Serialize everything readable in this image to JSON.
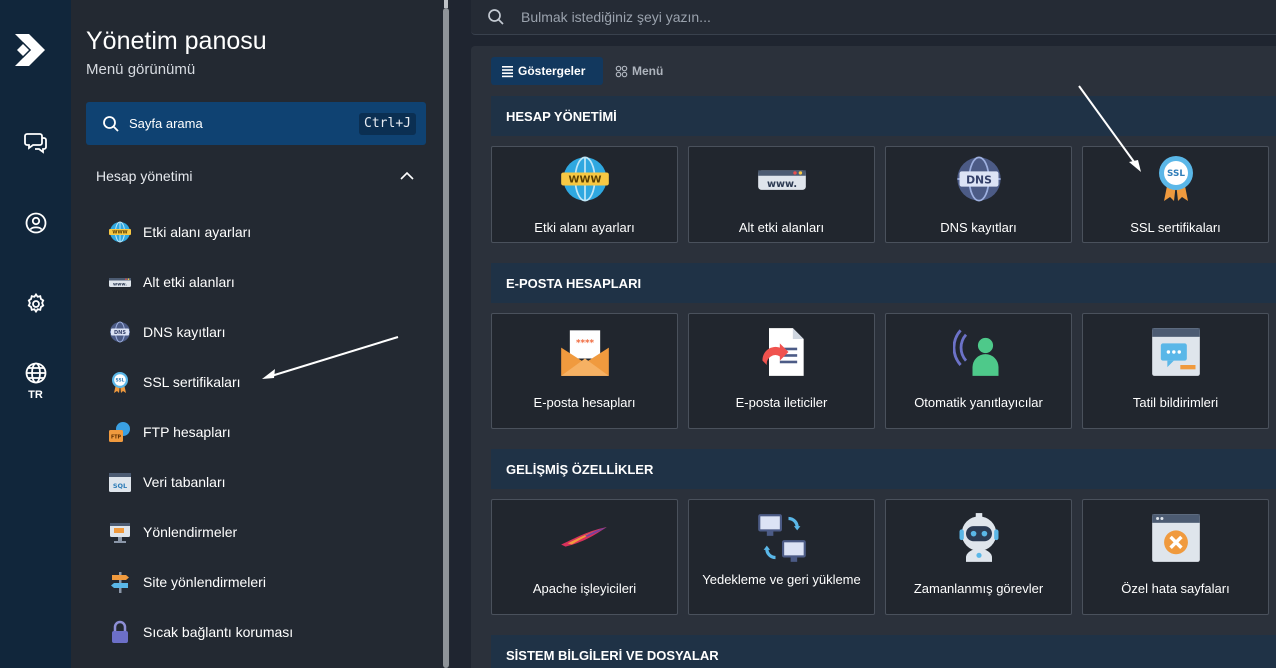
{
  "rail": {
    "items": [
      {
        "name": "messages-icon"
      },
      {
        "name": "account-icon"
      },
      {
        "name": "settings-icon"
      },
      {
        "name": "globe-icon",
        "label": "TR"
      }
    ]
  },
  "sidebar": {
    "title": "Yönetim panosu",
    "subtitle": "Menü görünümü",
    "search": {
      "label": "Sayfa arama",
      "shortcut": "Ctrl+J"
    },
    "section": "Hesap yönetimi",
    "items": [
      {
        "label": "Etki alanı ayarları",
        "icon": "www-globe-icon"
      },
      {
        "label": "Alt etki alanları",
        "icon": "subdomain-icon"
      },
      {
        "label": "DNS kayıtları",
        "icon": "dns-globe-icon"
      },
      {
        "label": "SSL sertifikaları",
        "icon": "ssl-badge-icon"
      },
      {
        "label": "FTP hesapları",
        "icon": "ftp-icon"
      },
      {
        "label": "Veri tabanları",
        "icon": "sql-icon"
      },
      {
        "label": "Yönlendirmeler",
        "icon": "redirect-icon"
      },
      {
        "label": "Site yönlendirmeleri",
        "icon": "signpost-icon"
      },
      {
        "label": "Sıcak bağlantı koruması",
        "icon": "lock-icon"
      }
    ]
  },
  "topbar": {
    "search_placeholder": "Bulmak istediğiniz şeyi yazın..."
  },
  "tabs": [
    {
      "label": "Göstergeler",
      "active": true
    },
    {
      "label": "Menü",
      "active": false
    }
  ],
  "sections": [
    {
      "title": "HESAP YÖNETİMİ",
      "cards": [
        {
          "label": "Etki alanı ayarları",
          "icon": "www-globe-icon"
        },
        {
          "label": "Alt etki alanları",
          "icon": "subdomain-icon"
        },
        {
          "label": "DNS kayıtları",
          "icon": "dns-globe-icon"
        },
        {
          "label": "SSL sertifikaları",
          "icon": "ssl-badge-icon"
        }
      ]
    },
    {
      "title": "E-POSTA HESAPLARI",
      "cards": [
        {
          "label": "E-posta hesapları",
          "icon": "envelope-icon"
        },
        {
          "label": "E-posta ileticiler",
          "icon": "mail-forward-icon"
        },
        {
          "label": "Otomatik yanıtlayıcılar",
          "icon": "auto-responder-icon"
        },
        {
          "label": "Tatil bildirimleri",
          "icon": "vacation-icon"
        }
      ]
    },
    {
      "title": "GELİŞMİŞ ÖZELLİKLER",
      "cards": [
        {
          "label": "Apache işleyicileri",
          "icon": "apache-feather-icon"
        },
        {
          "label": "Yedekleme ve geri yükleme",
          "icon": "backup-icon"
        },
        {
          "label": "Zamanlanmış görevler",
          "icon": "robot-icon"
        },
        {
          "label": "Özel hata sayfaları",
          "icon": "error-page-icon"
        }
      ]
    },
    {
      "title": "SİSTEM BİLGİLERİ VE DOSYALAR",
      "cards": []
    }
  ],
  "colors": {
    "rail_bg": "#11263b",
    "sidebar_bg": "#232932",
    "accent": "#0f4272",
    "section_bg": "#1f3246",
    "card_bg": "#21262e"
  }
}
